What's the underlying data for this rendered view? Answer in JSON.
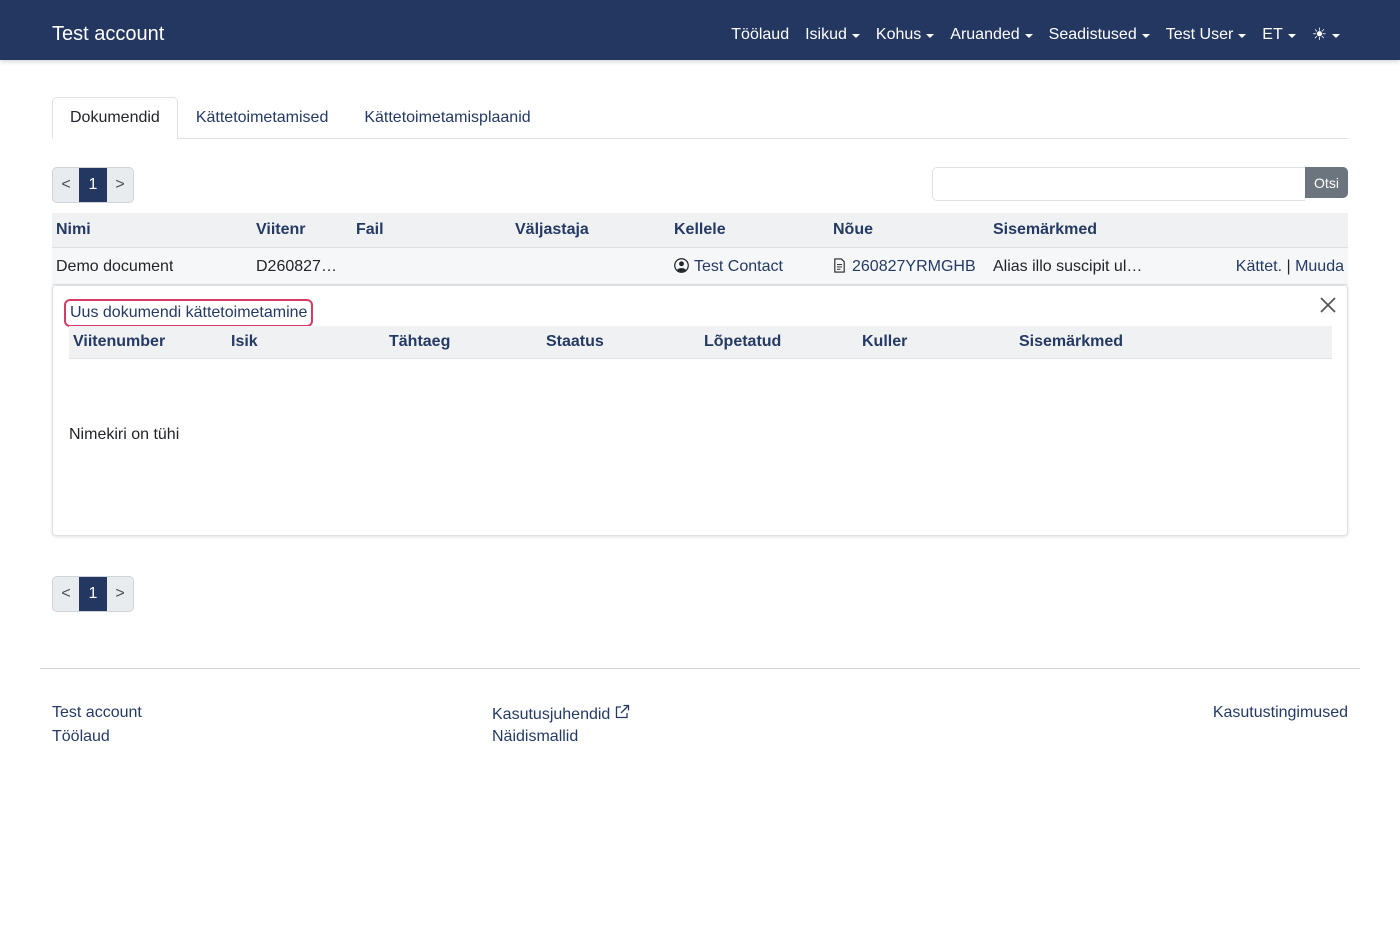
{
  "navbar": {
    "brand": "Test account",
    "items": [
      {
        "label": "Töölaud",
        "dropdown": false
      },
      {
        "label": "Isikud",
        "dropdown": true
      },
      {
        "label": "Kohus",
        "dropdown": true
      },
      {
        "label": "Aruanded",
        "dropdown": true
      },
      {
        "label": "Seadistused",
        "dropdown": true
      },
      {
        "label": "Test User",
        "dropdown": true
      },
      {
        "label": "ET",
        "dropdown": true
      }
    ],
    "theme_icon": "sun-icon",
    "color": "#243761"
  },
  "tabs": [
    {
      "label": "Dokumendid",
      "active": true
    },
    {
      "label": "Kättetoimetamised",
      "active": false
    },
    {
      "label": "Kättetoimetamisplaanid",
      "active": false
    }
  ],
  "pagination": {
    "prev": "<",
    "current": "1",
    "next": ">"
  },
  "search": {
    "value": "",
    "button": "Otsi"
  },
  "table": {
    "headers": {
      "name": "Nimi",
      "ref": "Viitenr",
      "file": "Fail",
      "issuer": "Väljastaja",
      "recipient": "Kellele",
      "claim": "Nõue",
      "notes": "Sisemärkmed"
    },
    "rows": [
      {
        "name": "Demo document",
        "ref": "D260827…",
        "file": "",
        "issuer": "",
        "recipient": "Test Contact",
        "claim": "260827YRMGHB",
        "notes": "Alias illo suscipit ul…",
        "action_deliver": "Kättet.",
        "separator": "|",
        "action_edit": "Muuda"
      }
    ]
  },
  "panel": {
    "new_link": "Uus dokumendi kättetoimetamine",
    "headers": {
      "ref": "Viitenumber",
      "person": "Isik",
      "deadline": "Tähtaeg",
      "status": "Staatus",
      "finished": "Lõpetatud",
      "courier": "Kuller",
      "notes": "Sisemärkmed"
    },
    "empty": "Nimekiri on tühi"
  },
  "footer": {
    "col1": [
      "Test account",
      "Töölaud"
    ],
    "col2": [
      "Kasutusjuhendid",
      "Näidismallid"
    ],
    "col3": [
      "Kasutustingimused"
    ]
  },
  "colors": {
    "accent": "#243a64",
    "highlight": "#d63b66"
  }
}
